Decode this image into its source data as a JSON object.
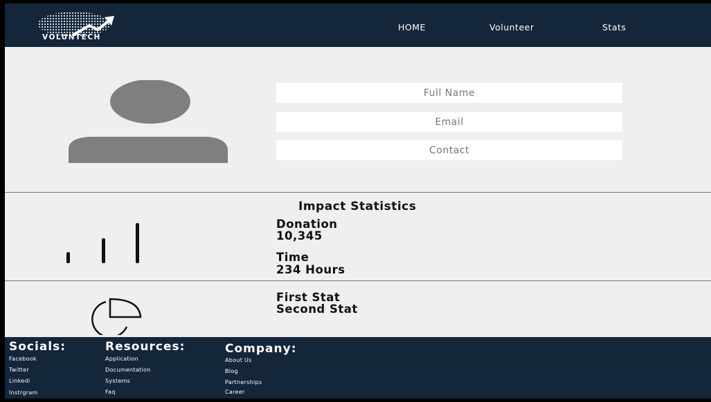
{
  "brand": {
    "name": "VOLUNTECH"
  },
  "nav": {
    "home": "HOME",
    "volunteer": "Volunteer",
    "stats": "Stats"
  },
  "profile": {
    "full_name_placeholder": "Full Name",
    "email_placeholder": "Email",
    "contact_placeholder": "Contact"
  },
  "stats": {
    "title": "Impact Statistics",
    "donation_label": "Donation",
    "donation_value": "10,345",
    "time_label": "Time",
    "time_value": "234 Hours",
    "first_stat": "First Stat",
    "second_stat": "Second Stat"
  },
  "footer": {
    "socials": {
      "heading": "Socials:",
      "links": [
        "Facebook",
        "Twitter",
        "Linkedi",
        "Instrgram"
      ]
    },
    "resources": {
      "heading": "Resources:",
      "links": [
        "Application",
        "Documentation",
        "Systems",
        "Faq"
      ]
    },
    "company": {
      "heading": "Company:",
      "links": [
        "About Us",
        "Blog",
        "Partnerships",
        "Career"
      ]
    }
  },
  "colors": {
    "nav_bg": "#14263a",
    "page_bg": "#efefef",
    "avatar": "#7f7f7f"
  },
  "icons": [
    "logo-globe-icon",
    "user-avatar-icon",
    "bar-chart-icon",
    "pie-chart-icon"
  ]
}
